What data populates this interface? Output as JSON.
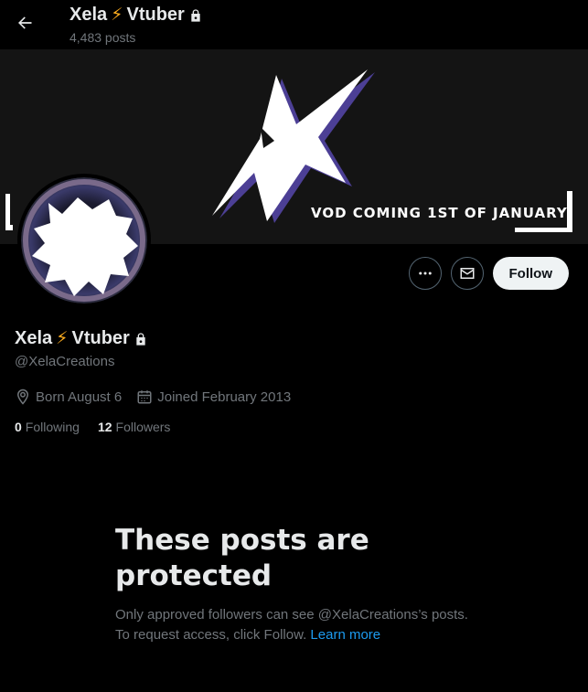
{
  "header": {
    "name_prefix": "Xela",
    "name_emoji": "⚡",
    "name_suffix": "Vtuber",
    "post_count": "4,483 posts"
  },
  "banner": {
    "text": "VOD COMING 1ST OF JANUARY"
  },
  "actions": {
    "follow_label": "Follow"
  },
  "profile": {
    "name_prefix": "Xela",
    "name_emoji": "⚡",
    "name_suffix": "Vtuber",
    "handle": "@XelaCreations",
    "born": "Born August 6",
    "joined": "Joined February 2013",
    "following_count": "0",
    "following_label": "Following",
    "followers_count": "12",
    "followers_label": "Followers"
  },
  "protected": {
    "title": "These posts are protected",
    "body": "Only approved followers can see @XelaCreations’s posts. To request access, click Follow.",
    "learn_more": "Learn more"
  },
  "colors": {
    "background": "#000000",
    "text": "#e7e9ea",
    "muted": "#71767b",
    "link": "#1d9bf0",
    "follow_bg": "#eff3f4"
  }
}
